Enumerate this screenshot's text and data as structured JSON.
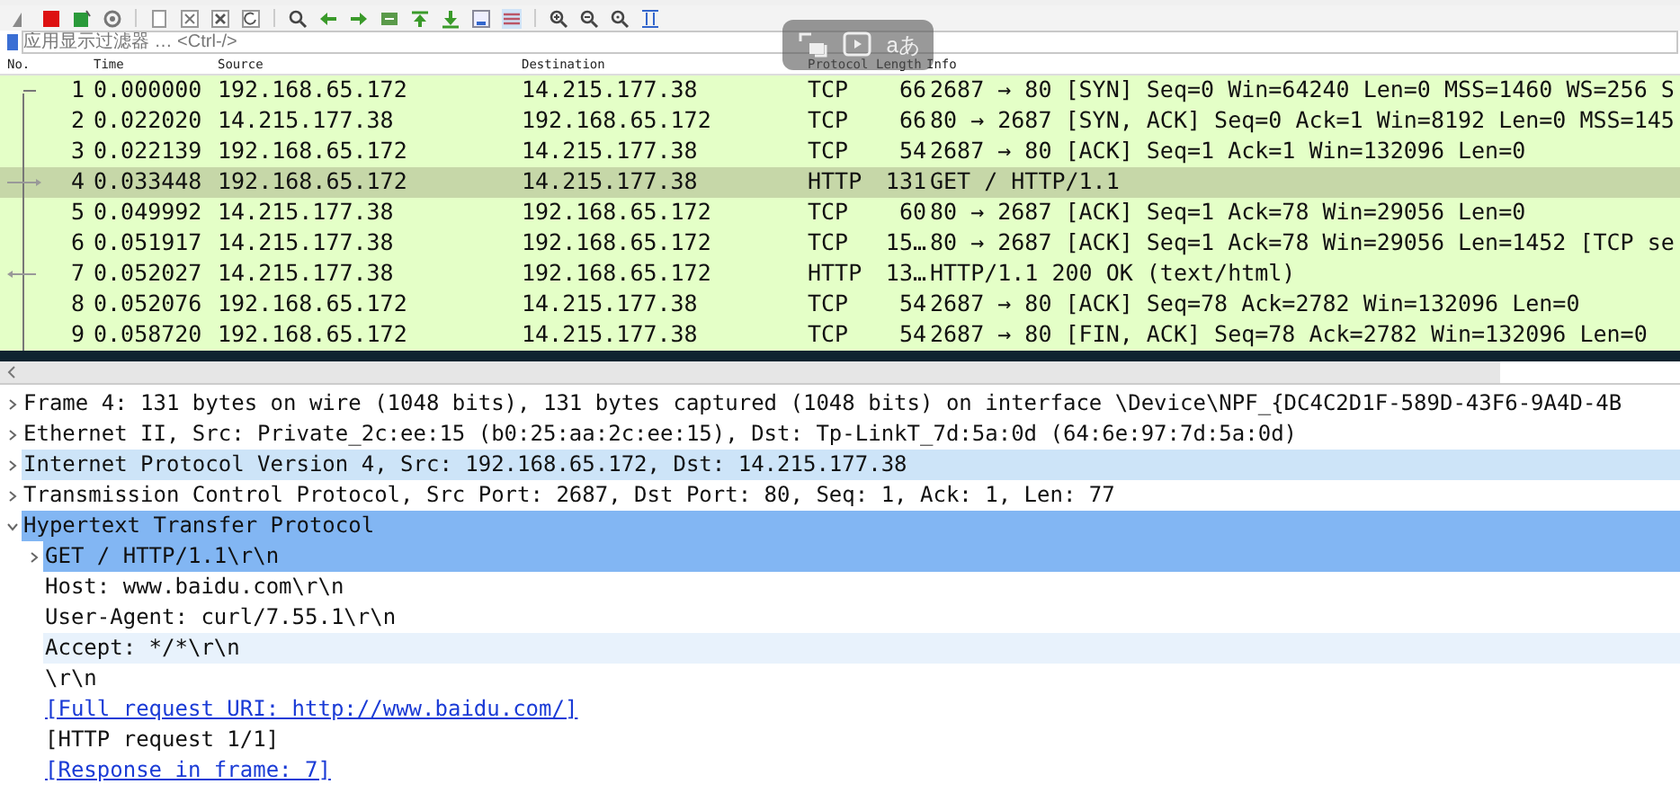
{
  "toolbar": [
    {
      "kind": "fin"
    },
    {
      "kind": "stop"
    },
    {
      "kind": "restart"
    },
    {
      "kind": "options"
    },
    {
      "kind": "sep"
    },
    {
      "kind": "open"
    },
    {
      "kind": "save"
    },
    {
      "kind": "close"
    },
    {
      "kind": "reload"
    },
    {
      "kind": "sep"
    },
    {
      "kind": "search"
    },
    {
      "kind": "back"
    },
    {
      "kind": "forward"
    },
    {
      "kind": "goto"
    },
    {
      "kind": "first"
    },
    {
      "kind": "last"
    },
    {
      "kind": "autoscroll"
    },
    {
      "kind": "colorize"
    },
    {
      "kind": "sep"
    },
    {
      "kind": "zoom-in"
    },
    {
      "kind": "zoom-out"
    },
    {
      "kind": "zoom-reset"
    },
    {
      "kind": "resize"
    }
  ],
  "filter": {
    "placeholder": "应用显示过滤器 … <Ctrl-/>"
  },
  "overlay": {
    "caption_label": "aあ"
  },
  "columns": [
    "No.",
    "Time",
    "Source",
    "Destination",
    "Protocol",
    "Length",
    "Info"
  ],
  "packets": [
    {
      "no": "1",
      "time": "0.000000",
      "source": "192.168.65.172",
      "destination": "14.215.177.38",
      "protocol": "TCP",
      "length": "66",
      "info": "2687 → 80 [SYN] Seq=0 Win=64240 Len=0 MSS=1460 WS=256 S",
      "selected": false,
      "kind": "start"
    },
    {
      "no": "2",
      "time": "0.022020",
      "source": "14.215.177.38",
      "destination": "192.168.65.172",
      "protocol": "TCP",
      "length": "66",
      "info": "80 → 2687 [SYN, ACK] Seq=0 Ack=1 Win=8192 Len=0 MSS=145",
      "selected": false,
      "kind": "plain"
    },
    {
      "no": "3",
      "time": "0.022139",
      "source": "192.168.65.172",
      "destination": "14.215.177.38",
      "protocol": "TCP",
      "length": "54",
      "info": "2687 → 80 [ACK] Seq=1 Ack=1 Win=132096 Len=0",
      "selected": false,
      "kind": "plain"
    },
    {
      "no": "4",
      "time": "0.033448",
      "source": "192.168.65.172",
      "destination": "14.215.177.38",
      "protocol": "HTTP",
      "length": "131",
      "info": "GET / HTTP/1.1",
      "selected": true,
      "kind": "request"
    },
    {
      "no": "5",
      "time": "0.049992",
      "source": "14.215.177.38",
      "destination": "192.168.65.172",
      "protocol": "TCP",
      "length": "60",
      "info": "80 → 2687 [ACK] Seq=1 Ack=78 Win=29056 Len=0",
      "selected": false,
      "kind": "plain"
    },
    {
      "no": "6",
      "time": "0.051917",
      "source": "14.215.177.38",
      "destination": "192.168.65.172",
      "protocol": "TCP",
      "length": "15…",
      "info": "80 → 2687 [ACK] Seq=1 Ack=78 Win=29056 Len=1452 [TCP se",
      "selected": false,
      "kind": "plain"
    },
    {
      "no": "7",
      "time": "0.052027",
      "source": "14.215.177.38",
      "destination": "192.168.65.172",
      "protocol": "HTTP",
      "length": "13…",
      "info": "HTTP/1.1 200 OK  (text/html)",
      "selected": false,
      "kind": "response"
    },
    {
      "no": "8",
      "time": "0.052076",
      "source": "192.168.65.172",
      "destination": "14.215.177.38",
      "protocol": "TCP",
      "length": "54",
      "info": "2687 → 80 [ACK] Seq=78 Ack=2782 Win=132096 Len=0",
      "selected": false,
      "kind": "plain"
    },
    {
      "no": "9",
      "time": "0.058720",
      "source": "192.168.65.172",
      "destination": "14.215.177.38",
      "protocol": "TCP",
      "length": "54",
      "info": "2687 → 80 [FIN, ACK] Seq=78 Ack=2782 Win=132096 Len=0",
      "selected": false,
      "kind": "plain"
    }
  ],
  "details": [
    {
      "text": "Frame 4: 131 bytes on wire (1048 bits), 131 bytes captured (1048 bits) on interface \\Device\\NPF_{DC4C2D1F-589D-43F6-9A4D-4B",
      "expanded": false,
      "selected": false,
      "highlighted": false,
      "hovered": false
    },
    {
      "text": "Ethernet II, Src: Private_2c:ee:15 (b0:25:aa:2c:ee:15), Dst: Tp-LinkT_7d:5a:0d (64:6e:97:7d:5a:0d)",
      "expanded": false,
      "selected": false,
      "highlighted": false,
      "hovered": false
    },
    {
      "text": "Internet Protocol Version 4, Src: 192.168.65.172, Dst: 14.215.177.38",
      "expanded": false,
      "selected": false,
      "highlighted": true,
      "hovered": false
    },
    {
      "text": "Transmission Control Protocol, Src Port: 2687, Dst Port: 80, Seq: 1, Ack: 1, Len: 77",
      "expanded": false,
      "selected": false,
      "highlighted": false,
      "hovered": false
    },
    {
      "text": "Hypertext Transfer Protocol",
      "expanded": true,
      "selected": true,
      "highlighted": false,
      "hovered": false,
      "children": [
        {
          "text": "GET / HTTP/1.1\\r\\n",
          "expanded": false,
          "selected": true,
          "highlighted": false,
          "hovered": false
        },
        {
          "text": "Host: www.baidu.com\\r\\n",
          "selected": false,
          "highlighted": false,
          "hovered": false
        },
        {
          "text": "User-Agent: curl/7.55.1\\r\\n",
          "selected": false,
          "highlighted": false,
          "hovered": false
        },
        {
          "text": "Accept: */*\\r\\n",
          "selected": false,
          "highlighted": false,
          "hovered": true
        },
        {
          "text": "\\r\\n",
          "selected": false,
          "highlighted": false,
          "hovered": false
        },
        {
          "text": "[Full request URI: http://www.baidu.com/]",
          "selected": false,
          "highlighted": false,
          "hovered": false,
          "link": true
        },
        {
          "text": "[HTTP request 1/1]",
          "selected": false,
          "highlighted": false,
          "hovered": false
        },
        {
          "text": "[Response in frame: 7]",
          "selected": false,
          "highlighted": false,
          "hovered": false,
          "link": true
        }
      ]
    }
  ]
}
